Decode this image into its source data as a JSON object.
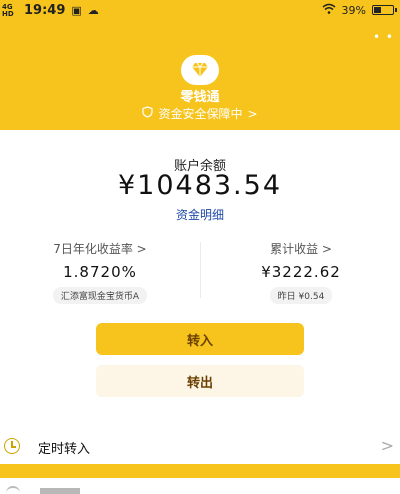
{
  "status_bar": {
    "network": "4G HD",
    "time": "19:49",
    "battery": "39%",
    "battery_level": 0.39
  },
  "header": {
    "product_name": "零钱通",
    "safety_text": "资金安全保障中",
    "safety_chevron": ">",
    "menu_dots": "• •",
    "logo_icon": "diamond-icon",
    "accent_color": "#f6c41c"
  },
  "balance": {
    "label": "账户余额",
    "amount": "¥10483.54",
    "detail_link": "资金明细"
  },
  "stats": {
    "yield": {
      "title": "7日年化收益率 >",
      "value": "1.8720%",
      "fund": "汇添富现金宝货币A"
    },
    "income": {
      "title": "累计收益 >",
      "value": "¥3222.62",
      "yesterday": "昨日 ¥0.54"
    }
  },
  "actions": {
    "transfer_in": "转入",
    "transfer_out": "转出"
  },
  "scheduled": {
    "label": "定时转入",
    "chevron": ">"
  }
}
